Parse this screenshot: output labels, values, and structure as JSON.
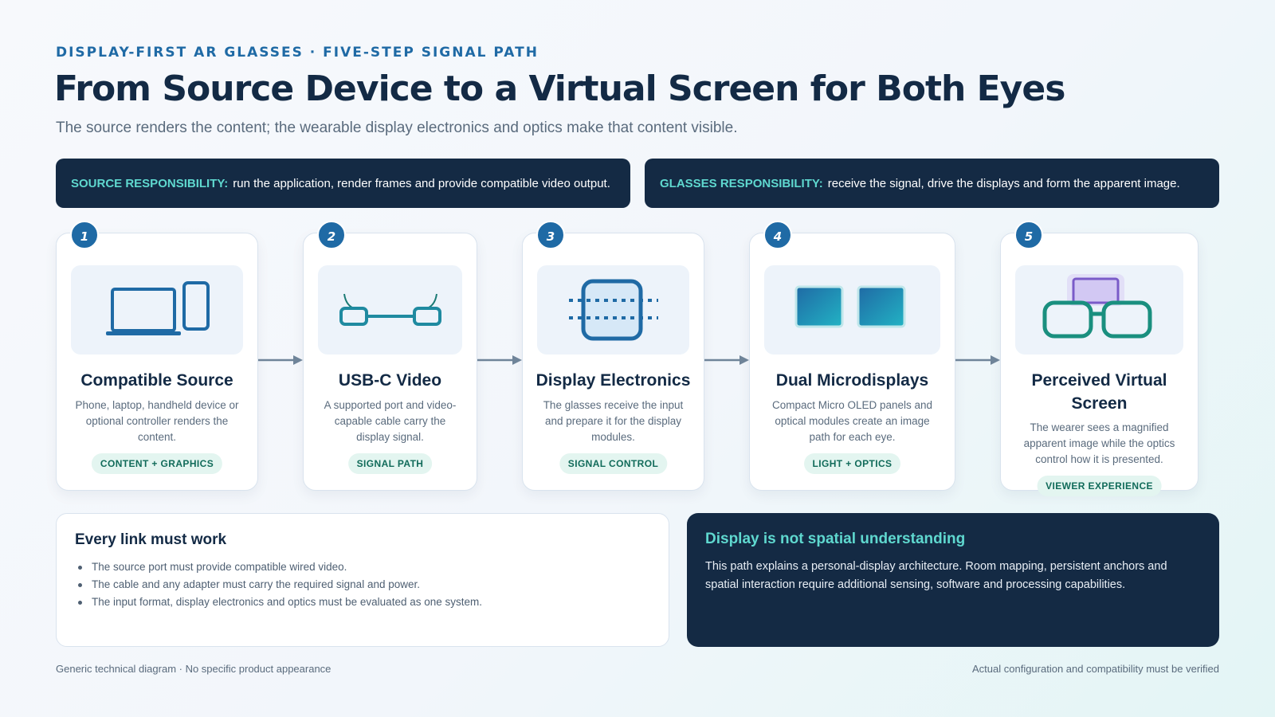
{
  "header": {
    "eyebrow": "DISPLAY-FIRST AR GLASSES · FIVE-STEP SIGNAL PATH",
    "title": "From Source Device to a Virtual Screen for Both Eyes",
    "subtitle": "The source renders the content; the wearable display electronics and optics make that content visible."
  },
  "responsibilities": {
    "source": {
      "label": "SOURCE RESPONSIBILITY:",
      "text": "run the application, render frames and provide compatible video output."
    },
    "glasses": {
      "label": "GLASSES RESPONSIBILITY:",
      "text": "receive the signal, drive the displays and form the apparent image."
    }
  },
  "steps": [
    {
      "number": "1",
      "icon": "laptop-phone-icon",
      "title": "Compatible Source",
      "description": "Phone, laptop, handheld device or optional controller renders the content.",
      "tag": "CONTENT + GRAPHICS"
    },
    {
      "number": "2",
      "icon": "usb-c-cable-icon",
      "title": "USB-C Video",
      "description": "A supported port and video-capable cable carry the display signal.",
      "tag": "SIGNAL PATH"
    },
    {
      "number": "3",
      "icon": "chip-icon",
      "title": "Display Electronics",
      "description": "The glasses receive the input and prepare it for the display modules.",
      "tag": "SIGNAL CONTROL"
    },
    {
      "number": "4",
      "icon": "dual-display-icon",
      "title": "Dual Microdisplays",
      "description": "Compact Micro OLED panels and optical modules create an image path for each eye.",
      "tag": "LIGHT + OPTICS"
    },
    {
      "number": "5",
      "icon": "glasses-screen-icon",
      "title": "Perceived Virtual Screen",
      "description": "The wearer sees a magnified apparent image while the optics control how it is presented.",
      "tag": "VIEWER EXPERIENCE"
    }
  ],
  "notes": {
    "left": {
      "title": "Every link must work",
      "items": [
        "The source port must provide compatible wired video.",
        "The cable and any adapter must carry the required signal and power.",
        "The input format, display electronics and optics must be evaluated as one system."
      ]
    },
    "right": {
      "title": "Display is not spatial understanding",
      "text": "This path explains a personal-display architecture. Room mapping, persistent anchors and spatial interaction require additional sensing, software and processing capabilities."
    }
  },
  "footer": {
    "left": "Generic technical diagram · No specific product appearance",
    "right": "Actual configuration and compatibility must be verified"
  },
  "colors": {
    "navy": "#142a44",
    "accent_blue": "#1f6aa5",
    "teal": "#5fd8cf",
    "pill_text": "#116b5a"
  }
}
